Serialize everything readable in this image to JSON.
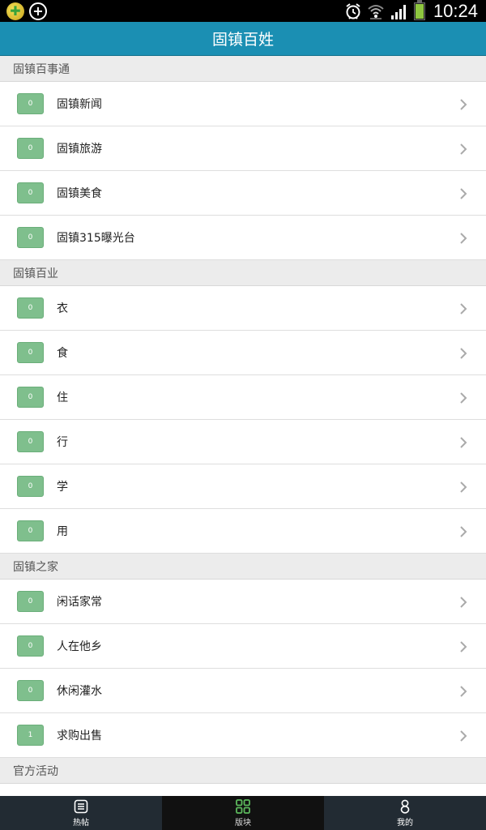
{
  "status_bar": {
    "time": "10:24"
  },
  "header": {
    "title": "固镇百姓"
  },
  "sections": [
    {
      "title": "固镇百事通",
      "items": [
        {
          "count": "0",
          "label": "固镇新闻"
        },
        {
          "count": "0",
          "label": "固镇旅游"
        },
        {
          "count": "0",
          "label": "固镇美食"
        },
        {
          "count": "0",
          "label": "固镇315曝光台"
        }
      ]
    },
    {
      "title": "固镇百业",
      "items": [
        {
          "count": "0",
          "label": "衣"
        },
        {
          "count": "0",
          "label": "食"
        },
        {
          "count": "0",
          "label": "住"
        },
        {
          "count": "0",
          "label": "行"
        },
        {
          "count": "0",
          "label": "学"
        },
        {
          "count": "0",
          "label": "用"
        }
      ]
    },
    {
      "title": "固镇之家",
      "items": [
        {
          "count": "0",
          "label": "闲话家常"
        },
        {
          "count": "0",
          "label": "人在他乡"
        },
        {
          "count": "0",
          "label": "休闲灌水"
        },
        {
          "count": "1",
          "label": "求购出售"
        }
      ]
    },
    {
      "title": "官方活动",
      "items": []
    }
  ],
  "bottom_nav": [
    {
      "label": "热帖",
      "icon": "hot-posts-icon",
      "active": false
    },
    {
      "label": "版块",
      "icon": "sections-grid-icon",
      "active": true
    },
    {
      "label": "我的",
      "icon": "profile-icon",
      "active": false
    }
  ],
  "colors": {
    "header": "#1b8fb3",
    "badge": "#7fbf8d",
    "active_nav_icon": "#5cb85c"
  }
}
